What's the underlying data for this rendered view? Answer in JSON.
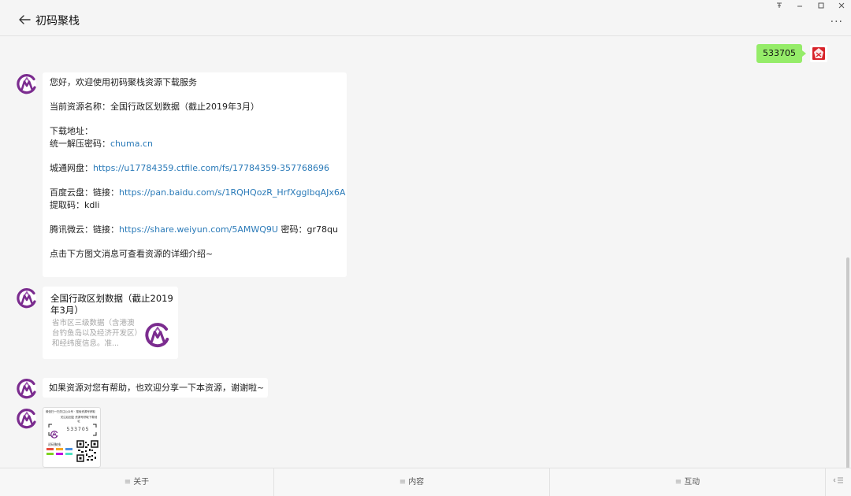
{
  "window": {
    "title": "初码聚栈",
    "controls": [
      "pin-icon",
      "minimize-icon",
      "maximize-icon",
      "close-icon"
    ],
    "more_label": "···"
  },
  "colors": {
    "accent_purple": "#7b2c8f",
    "sent_bubble": "#95ec69",
    "link": "#2a7ab8"
  },
  "chat": {
    "sent_message": "533705",
    "welcome": {
      "greeting": "您好，欢迎使用初码聚栈资源下载服务",
      "resource_label": "当前资源名称：",
      "resource_name": "全国行政区划数据（截止2019年3月）",
      "download_label": "下载地址：",
      "password_label": "统一解压密码：",
      "password_value": "chuma.cn",
      "ctfile_label": "城通网盘：",
      "ctfile_url": "https://u17784359.ctfile.com/fs/17784359-357768696",
      "baidu_label": "百度云盘：链接：",
      "baidu_url": "https://pan.baidu.com/s/1RQHQozR_HrfXgglbqAJx6A",
      "baidu_code": "提取码：kdli",
      "weiyun_label": "腾讯微云：链接：",
      "weiyun_url": "https://share.weiyun.com/5AMWQ9U",
      "weiyun_code": " 密码：gr78qu",
      "footer": "点击下方图文消息可查看资源的详细介绍~"
    },
    "card": {
      "title": "全国行政区划数据（截止2019年3月）",
      "description": "省市区三级数据（含港澳台钓鱼岛以及经济开发区）和经纬度信息。准..."
    },
    "share_message": "如果资源对您有帮助，也欢迎分享一下本资源，谢谢啦~",
    "image": {
      "header": "微信扫一扫关注公众号 · 搜索资源号获取",
      "subtitle": "关注后回复 资源号获取下载地址",
      "code": "533705",
      "name": "初码聚栈"
    }
  },
  "bottom_menu": {
    "items": [
      {
        "icon": "menu-icon",
        "label": "关于"
      },
      {
        "icon": "menu-icon",
        "label": "内容"
      },
      {
        "icon": "menu-icon",
        "label": "互动"
      }
    ],
    "keyboard_icon": "keyboard-toggle-icon"
  }
}
